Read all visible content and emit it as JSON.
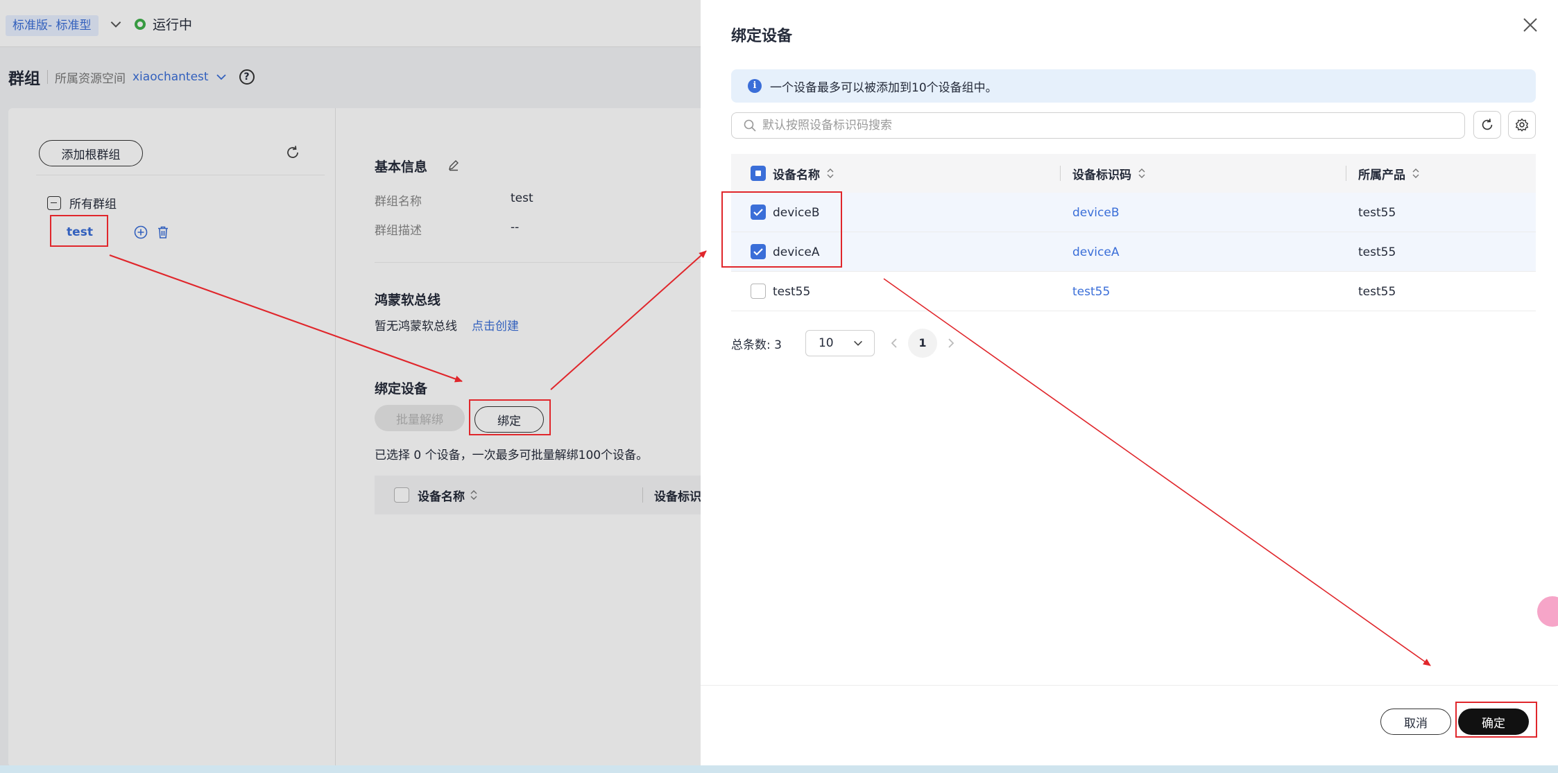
{
  "topbar": {
    "edition": "标准版- 标准型",
    "status": "运行中",
    "status_color": "#3fb04a"
  },
  "breadcrumb": {
    "title": "群组",
    "space_label": "所属资源空间",
    "space_value": "xiaochantest"
  },
  "tree": {
    "add_root_label": "添加根群组",
    "root_label": "所有群组",
    "node_label": "test"
  },
  "info": {
    "basic_title": "基本信息",
    "name_label": "群组名称",
    "name_value": "test",
    "desc_label": "群组描述",
    "desc_value": "--",
    "harmony_title": "鸿蒙软总线",
    "harmony_empty": "暂无鸿蒙软总线",
    "harmony_create": "点击创建",
    "bind_title": "绑定设备",
    "unbind_label": "批量解绑",
    "bind_label": "绑定",
    "selected_hint": "已选择 0 个设备，一次最多可批量解绑100个设备。",
    "col_name": "设备名称",
    "col_id": "设备标识码"
  },
  "drawer": {
    "title": "绑定设备",
    "notice": "一个设备最多可以被添加到10个设备组中。",
    "search_placeholder": "默认按照设备标识码搜索",
    "columns": [
      "设备名称",
      "设备标识码",
      "所属产品"
    ],
    "rows": [
      {
        "name": "deviceB",
        "id": "deviceB",
        "product": "test55",
        "checked": true
      },
      {
        "name": "deviceA",
        "id": "deviceA",
        "product": "test55",
        "checked": true
      },
      {
        "name": "test55",
        "id": "test55",
        "product": "test55",
        "checked": false
      }
    ],
    "total_label": "总条数:",
    "total_value": "3",
    "page_size": "10",
    "current_page": "1",
    "cancel_label": "取消",
    "ok_label": "确定"
  },
  "colors": {
    "accent": "#3a6ed8",
    "annotation": "#e0262b"
  }
}
